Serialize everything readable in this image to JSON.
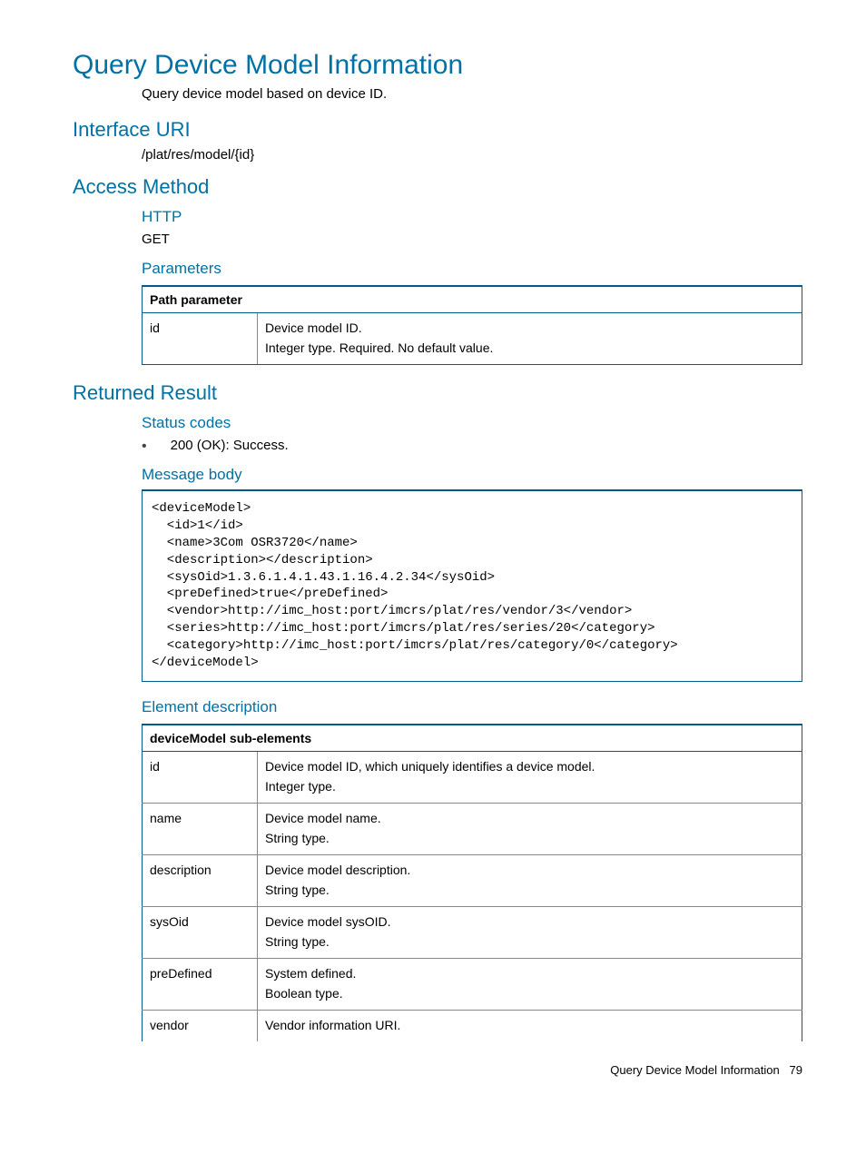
{
  "title": "Query Device Model Information",
  "intro": "Query device model based on device ID.",
  "interface_uri_heading": "Interface URI",
  "interface_uri": "/plat/res/model/{id}",
  "access_method_heading": "Access Method",
  "http_heading": "HTTP",
  "http_method": "GET",
  "parameters_heading": "Parameters",
  "param_table": {
    "header": "Path parameter",
    "rows": [
      {
        "name": "id",
        "lines": [
          "Device model ID.",
          "Integer type. Required. No default value."
        ]
      }
    ]
  },
  "returned_result_heading": "Returned Result",
  "status_codes_heading": "Status codes",
  "status_code_line": "200 (OK): Success.",
  "message_body_heading": "Message body",
  "code_block": "<deviceModel>\n  <id>1</id>\n  <name>3Com OSR3720</name>\n  <description></description>\n  <sysOid>1.3.6.1.4.1.43.1.16.4.2.34</sysOid>\n  <preDefined>true</preDefined>\n  <vendor>http://imc_host:port/imcrs/plat/res/vendor/3</vendor>\n  <series>http://imc_host:port/imcrs/plat/res/series/20</category>\n  <category>http://imc_host:port/imcrs/plat/res/category/0</category>\n</deviceModel>",
  "element_description_heading": "Element description",
  "elem_table": {
    "header": "deviceModel sub-elements",
    "rows": [
      {
        "name": "id",
        "lines": [
          "Device model ID, which uniquely identifies a device model.",
          "Integer type."
        ]
      },
      {
        "name": "name",
        "lines": [
          "Device model name.",
          "String type."
        ]
      },
      {
        "name": "description",
        "lines": [
          "Device model description.",
          "String type."
        ]
      },
      {
        "name": "sysOid",
        "lines": [
          "Device model sysOID.",
          "String type."
        ]
      },
      {
        "name": "preDefined",
        "lines": [
          "System defined.",
          "Boolean type."
        ]
      },
      {
        "name": "vendor",
        "lines": [
          "Vendor information URI."
        ]
      }
    ]
  },
  "footer_title": "Query Device Model Information",
  "footer_page": "79"
}
